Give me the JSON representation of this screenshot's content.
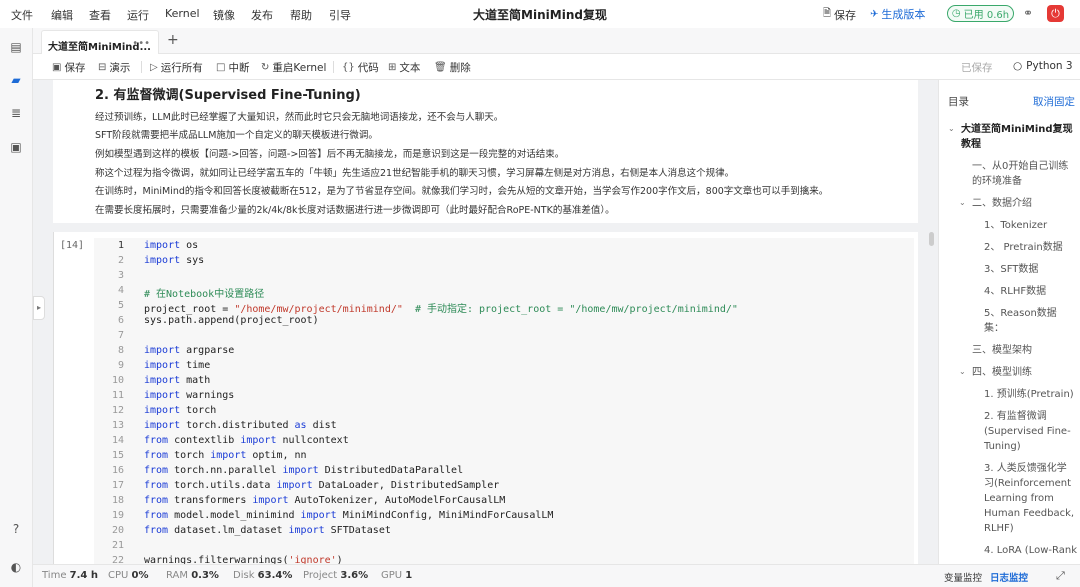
{
  "menu": [
    "文件",
    "编辑",
    "查看",
    "运行",
    "Kernel",
    "镜像",
    "发布",
    "帮助",
    "引导"
  ],
  "app_title": "大道至简MiniMind复现",
  "top_actions": {
    "save": "保存",
    "publish": "生成版本",
    "usage": "已用 0.6h"
  },
  "tab": {
    "name": "大道至简MiniMind...",
    "close": "•••",
    "add": "+"
  },
  "toolbar": {
    "save": "保存",
    "present": "演示",
    "run_all": "运行所有",
    "interrupt": "中断",
    "restart": "重启Kernel",
    "code": "代码",
    "text": "文本",
    "delete": "删除",
    "saved_status": "已保存",
    "kernel": "Python 3"
  },
  "markdown": {
    "heading": "2. 有监督微调(Supervised Fine-Tuning)",
    "lines": [
      "经过预训练，LLM此时已经掌握了大量知识，然而此时它只会无脑地词语接龙，还不会与人聊天。",
      "SFT阶段就需要把半成品LLM施加一个自定义的聊天模板进行微调。",
      "例如模型遇到这样的模板【问题->回答，问题->回答】后不再无脑接龙，而是意识到这是一段完整的对话结束。",
      "称这个过程为指令微调，就如同让已经学富五车的「牛顿」先生适应21世纪智能手机的聊天习惯，学习屏幕左侧是对方消息，右侧是本人消息这个规律。",
      "在训练时，MiniMind的指令和回答长度被截断在512，是为了节省显存空间。就像我们学习时，会先从短的文章开始，当学会写作200字作文后，800字文章也可以手到擒来。",
      "在需要长度拓展时，只需要准备少量的2k/4k/8k长度对话数据进行进一步微调即可（此时最好配合RoPE-NTK的基准差值）。"
    ]
  },
  "code_cell": {
    "prompt": "[14]",
    "lines": [
      {
        "n": "1",
        "segs": [
          [
            "kw",
            "import"
          ],
          [
            "t",
            " os"
          ]
        ]
      },
      {
        "n": "2",
        "segs": [
          [
            "kw",
            "import"
          ],
          [
            "t",
            " sys"
          ]
        ]
      },
      {
        "n": "3",
        "segs": []
      },
      {
        "n": "4",
        "segs": [
          [
            "cm",
            "# 在Notebook中设置路径"
          ]
        ]
      },
      {
        "n": "5",
        "segs": [
          [
            "t",
            "project_root = "
          ],
          [
            "str",
            "\"/home/mw/project/minimind/\""
          ],
          [
            "t",
            "  "
          ],
          [
            "cm",
            "# 手动指定: project_root = \"/home/mw/project/minimind/\""
          ]
        ]
      },
      {
        "n": "6",
        "segs": [
          [
            "t",
            "sys.path.append(project_root)"
          ]
        ]
      },
      {
        "n": "7",
        "segs": []
      },
      {
        "n": "8",
        "segs": [
          [
            "kw",
            "import"
          ],
          [
            "t",
            " argparse"
          ]
        ]
      },
      {
        "n": "9",
        "segs": [
          [
            "kw",
            "import"
          ],
          [
            "t",
            " time"
          ]
        ]
      },
      {
        "n": "10",
        "segs": [
          [
            "kw",
            "import"
          ],
          [
            "t",
            " math"
          ]
        ]
      },
      {
        "n": "11",
        "segs": [
          [
            "kw",
            "import"
          ],
          [
            "t",
            " warnings"
          ]
        ]
      },
      {
        "n": "12",
        "segs": [
          [
            "kw",
            "import"
          ],
          [
            "t",
            " torch"
          ]
        ]
      },
      {
        "n": "13",
        "segs": [
          [
            "kw",
            "import"
          ],
          [
            "t",
            " torch.distributed "
          ],
          [
            "kw",
            "as"
          ],
          [
            "t",
            " dist"
          ]
        ]
      },
      {
        "n": "14",
        "segs": [
          [
            "kw",
            "from"
          ],
          [
            "t",
            " contextlib "
          ],
          [
            "kw",
            "import"
          ],
          [
            "t",
            " nullcontext"
          ]
        ]
      },
      {
        "n": "15",
        "segs": [
          [
            "kw",
            "from"
          ],
          [
            "t",
            " torch "
          ],
          [
            "kw",
            "import"
          ],
          [
            "t",
            " optim, nn"
          ]
        ]
      },
      {
        "n": "16",
        "segs": [
          [
            "kw",
            "from"
          ],
          [
            "t",
            " torch.nn.parallel "
          ],
          [
            "kw",
            "import"
          ],
          [
            "t",
            " DistributedDataParallel"
          ]
        ]
      },
      {
        "n": "17",
        "segs": [
          [
            "kw",
            "from"
          ],
          [
            "t",
            " torch.utils.data "
          ],
          [
            "kw",
            "import"
          ],
          [
            "t",
            " DataLoader, DistributedSampler"
          ]
        ]
      },
      {
        "n": "18",
        "segs": [
          [
            "kw",
            "from"
          ],
          [
            "t",
            " transformers "
          ],
          [
            "kw",
            "import"
          ],
          [
            "t",
            " AutoTokenizer, AutoModelForCausalLM"
          ]
        ]
      },
      {
        "n": "19",
        "segs": [
          [
            "kw",
            "from"
          ],
          [
            "t",
            " model.model_minimind "
          ],
          [
            "kw",
            "import"
          ],
          [
            "t",
            " MiniMindConfig, MiniMindForCausalLM"
          ]
        ]
      },
      {
        "n": "20",
        "segs": [
          [
            "kw",
            "from"
          ],
          [
            "t",
            " dataset.lm_dataset "
          ],
          [
            "kw",
            "import"
          ],
          [
            "t",
            " SFTDataset"
          ]
        ]
      },
      {
        "n": "21",
        "segs": []
      },
      {
        "n": "22",
        "segs": [
          [
            "t",
            "warnings.filterwarnings("
          ],
          [
            "str",
            "'ignore'"
          ],
          [
            "t",
            ")"
          ]
        ]
      }
    ]
  },
  "toc": {
    "title": "目录",
    "collapse": "取消固定",
    "items": [
      {
        "level": 0,
        "bold": true,
        "caret": "down",
        "lines": [
          "大道至简MiniMind复现",
          "教程"
        ]
      },
      {
        "level": 1,
        "lines": [
          "一、从0开始自己训练",
          "的环境准备"
        ]
      },
      {
        "level": 1,
        "caret": "down",
        "lines": [
          "二、数据介绍"
        ]
      },
      {
        "level": 2,
        "lines": [
          "1、Tokenizer"
        ]
      },
      {
        "level": 2,
        "lines": [
          "2、 Pretrain数据"
        ]
      },
      {
        "level": 2,
        "lines": [
          "3、SFT数据"
        ]
      },
      {
        "level": 2,
        "lines": [
          "4、RLHF数据"
        ]
      },
      {
        "level": 2,
        "lines": [
          "5、Reason数据",
          "集："
        ]
      },
      {
        "level": 1,
        "lines": [
          "三、模型架构"
        ]
      },
      {
        "level": 1,
        "caret": "down",
        "lines": [
          "四、模型训练"
        ]
      },
      {
        "level": 2,
        "lines": [
          "1. 预训练(Pretrain)"
        ]
      },
      {
        "level": 2,
        "lines": [
          "2. 有监督微调",
          "(Supervised Fine-",
          "Tuning)"
        ]
      },
      {
        "level": 2,
        "lines": [
          "3. 人类反馈强化学",
          "习(Reinforcement",
          "Learning from",
          "Human Feedback,",
          "RLHF)"
        ]
      },
      {
        "level": 2,
        "lines": [
          "4. LoRA (Low-Rank"
        ]
      }
    ]
  },
  "status": {
    "time_label": "Time",
    "time": "7.4 h",
    "cpu_label": "CPU",
    "cpu": "0%",
    "ram_label": "RAM",
    "ram": "0.3%",
    "disk_label": "Disk",
    "disk": "63.4%",
    "project_label": "Project",
    "project": "3.6%",
    "gpu_label": "GPU",
    "gpu": "1",
    "var_monitor": "变量监控",
    "log_monitor": "日志监控"
  }
}
